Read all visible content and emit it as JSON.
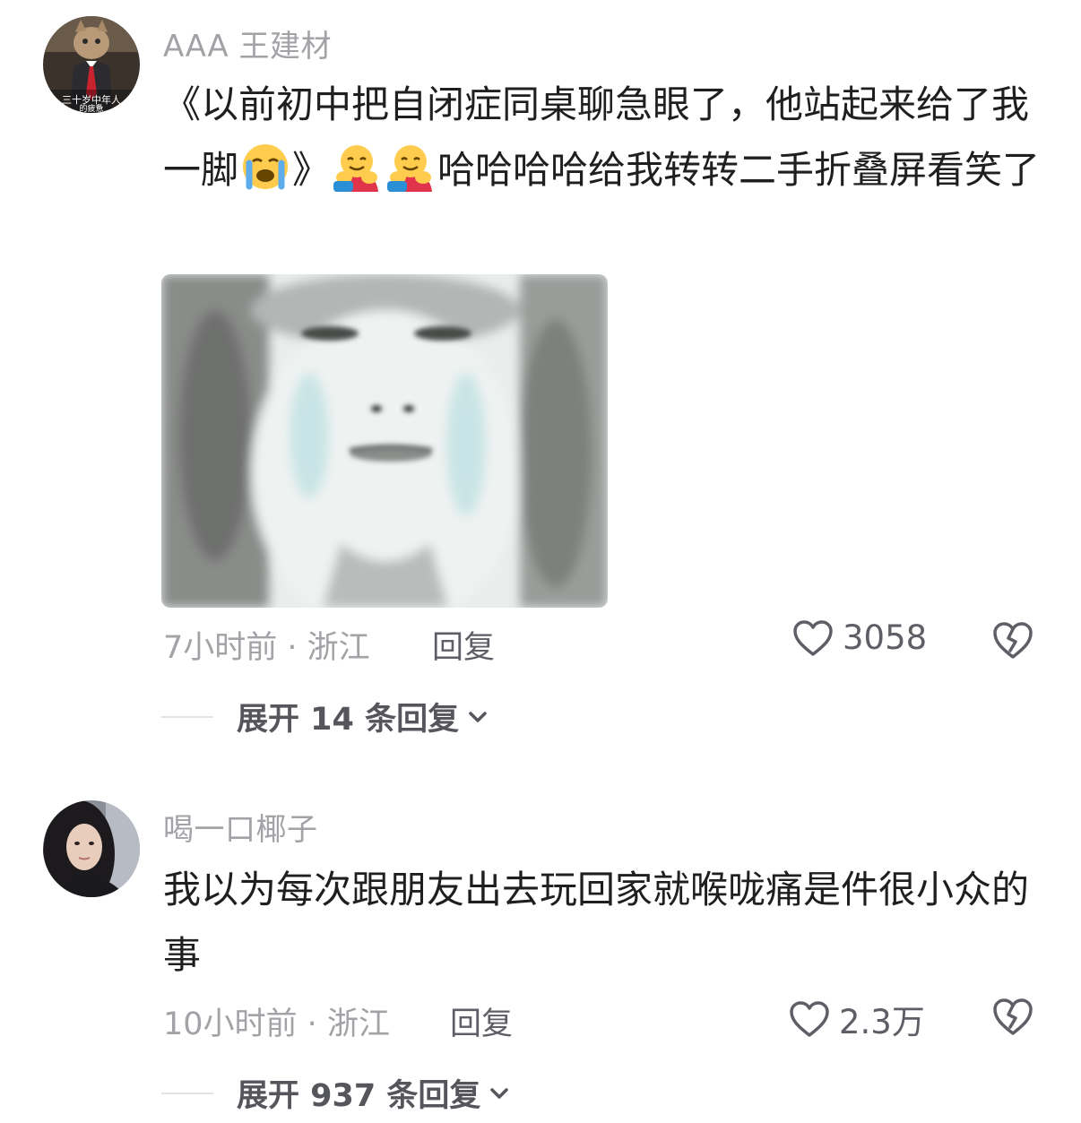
{
  "comments": [
    {
      "username": "AAA 王建材",
      "avatar_text_line1": "三十岁中年人",
      "avatar_text_line2": "的疲惫",
      "text_part1": "《以前初中把自闭症同桌聊急眼了，他站起来给了我一脚",
      "text_part2": "》",
      "text_part3": "哈哈哈哈给我转转二手折叠屏看笑了",
      "emojis": [
        "crying-emoji",
        "hugging-emoji",
        "hugging-emoji"
      ],
      "has_image": true,
      "time": "7小时前",
      "location": "浙江",
      "meta_separator": " · ",
      "reply_label": "回复",
      "likes": "3058",
      "expand_label": "展开 14 条回复"
    },
    {
      "username": "喝一口椰子",
      "text": "我以为每次跟朋友出去玩回家就喉咙痛是件很小众的事",
      "time": "10小时前",
      "location": "浙江",
      "meta_separator": " · ",
      "reply_label": "回复",
      "likes": "2.3万",
      "expand_label": "展开 937 条回复"
    }
  ],
  "colors": {
    "meta_gray": "#a2a2a7",
    "action_gray": "#5e5e66",
    "text": "#1f1f1f"
  }
}
